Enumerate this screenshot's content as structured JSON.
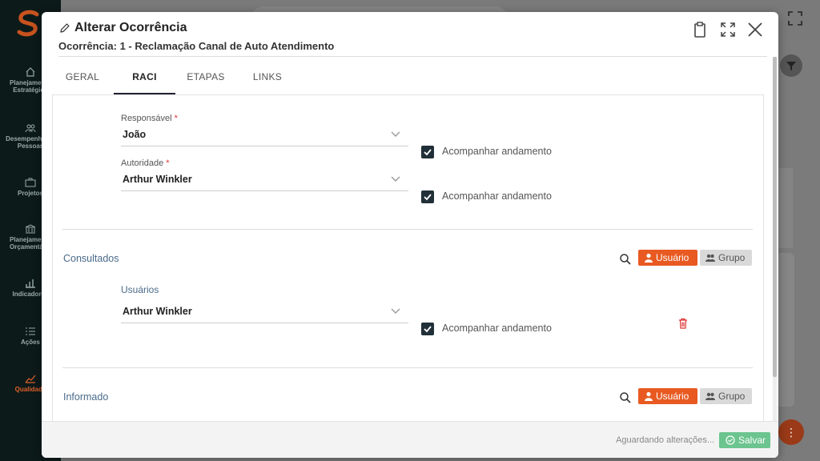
{
  "background": {
    "sidebar": [
      {
        "label": "Planejamento Estratégico",
        "icon": "home-icon",
        "active": false
      },
      {
        "label": "Desempenho de Pessoas",
        "icon": "people-icon",
        "active": false
      },
      {
        "label": "Projetos",
        "icon": "briefcase-icon",
        "active": false
      },
      {
        "label": "Planejamento Orçamentário",
        "icon": "bank-icon",
        "active": false
      },
      {
        "label": "Indicadores",
        "icon": "chart-icon",
        "active": false
      },
      {
        "label": "Ações",
        "icon": "list-icon",
        "active": false
      },
      {
        "label": "Qualidade",
        "icon": "trend-icon",
        "active": true
      }
    ],
    "colors": {
      "brand": "#e0612a",
      "sidebar": "#0d1a1a"
    }
  },
  "modal": {
    "title": "Alterar Ocorrência",
    "subtitle": "Ocorrência: 1 - Reclamação Canal de Auto Atendimento",
    "tabs": [
      {
        "label": "GERAL",
        "active": false
      },
      {
        "label": "RACI",
        "active": true
      },
      {
        "label": "ETAPAS",
        "active": false
      },
      {
        "label": "LINKS",
        "active": false
      }
    ],
    "responsavel": {
      "label": "Responsável",
      "required": "*",
      "value": "João",
      "follow_label": "Acompanhar andamento",
      "follow_checked": true
    },
    "autoridade": {
      "label": "Autoridade",
      "required": "*",
      "value": "Arthur Winkler",
      "follow_label": "Acompanhar andamento",
      "follow_checked": true
    },
    "consultados": {
      "title": "Consultados",
      "user_button": "Usuário",
      "group_button": "Grupo",
      "users_label": "Usuários",
      "users": [
        {
          "name": "Arthur Winkler",
          "follow_label": "Acompanhar andamento",
          "follow_checked": true
        }
      ]
    },
    "informado": {
      "title": "Informado",
      "user_button": "Usuário",
      "group_button": "Grupo"
    },
    "footer": {
      "status": "Aguardando alterações...",
      "save_label": "Salvar"
    },
    "colors": {
      "accent": "#e85a22",
      "save": "#6cc48f",
      "check": "#213038",
      "section": "#4a6a8a"
    }
  }
}
